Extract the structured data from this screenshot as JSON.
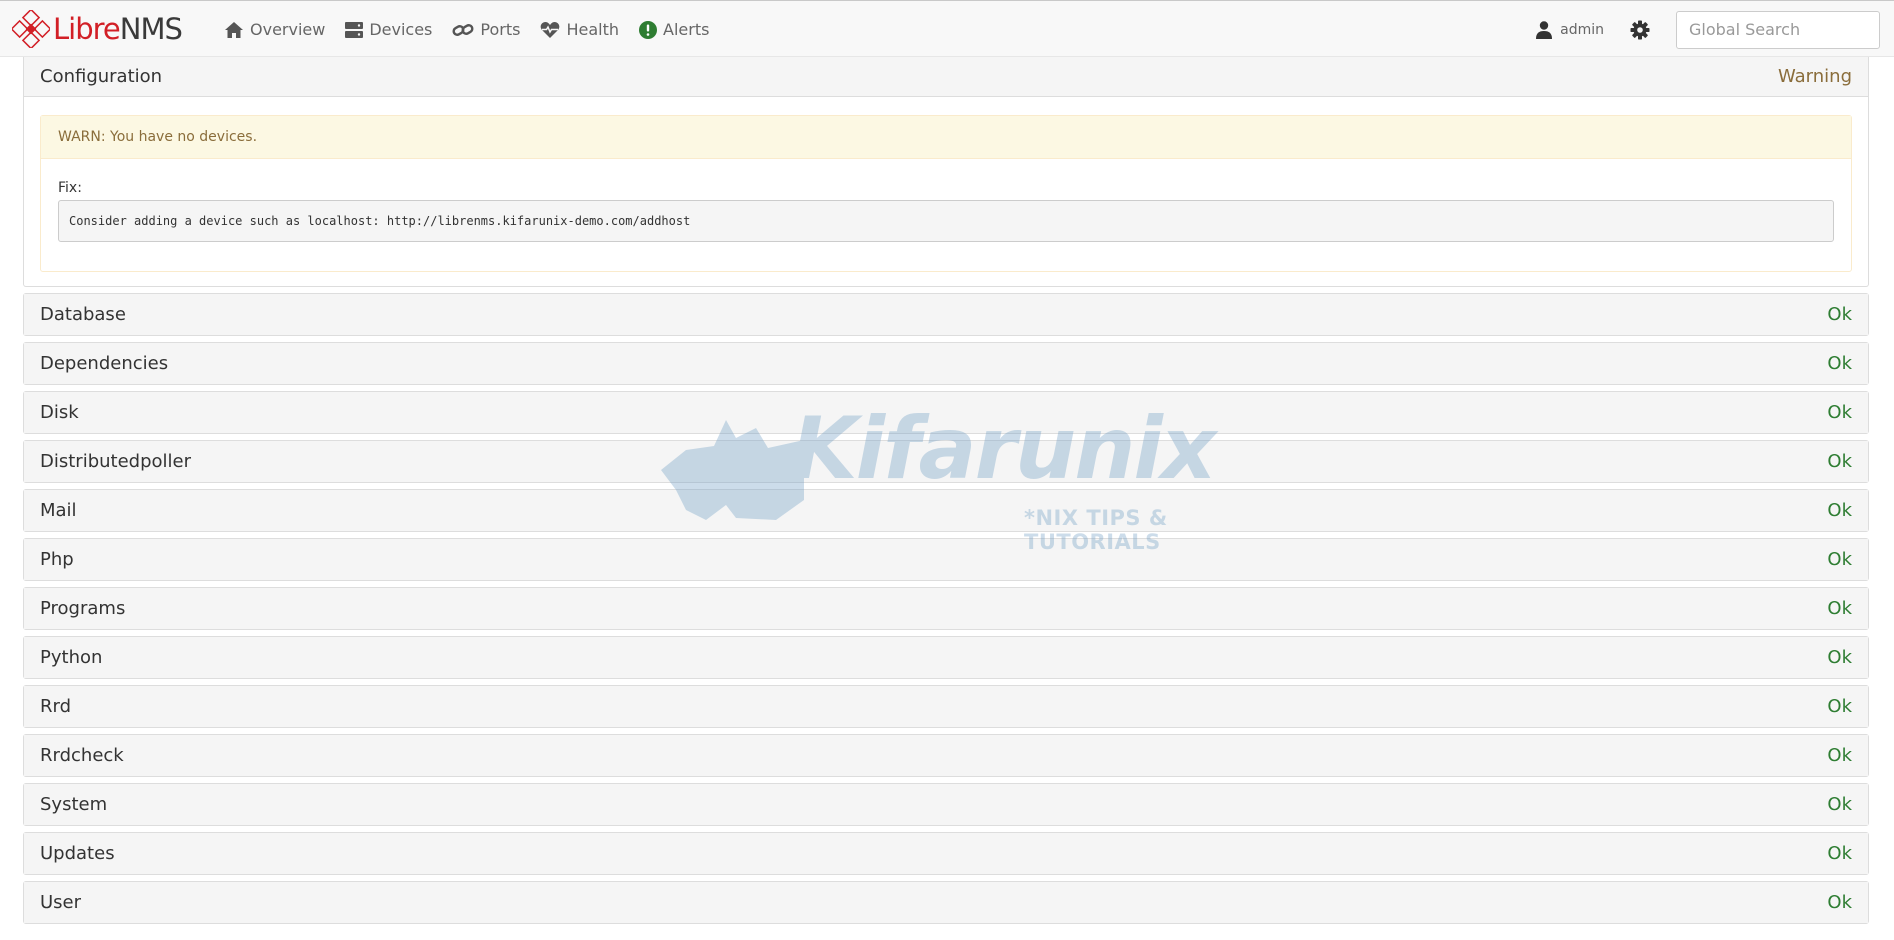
{
  "brand": {
    "part1": "Libre",
    "part2": "NMS"
  },
  "nav": {
    "items": [
      {
        "label": "Overview",
        "icon": "home-icon"
      },
      {
        "label": "Devices",
        "icon": "server-icon"
      },
      {
        "label": "Ports",
        "icon": "link-icon"
      },
      {
        "label": "Health",
        "icon": "heartbeat-icon"
      },
      {
        "label": "Alerts",
        "icon": "alert-circle-icon"
      }
    ],
    "user": "admin",
    "search_placeholder": "Global Search"
  },
  "colors": {
    "ok": "#2e7d32",
    "warning": "#8a6d3b",
    "alerts_icon": "#2e7d32",
    "brand_red": "#d21f26"
  },
  "configuration": {
    "title": "Configuration",
    "status": "Warning",
    "warn_message": "WARN: You have no devices.",
    "fix_label": "Fix:",
    "fix_text": "Consider adding a device such as localhost: http://librenms.kifarunix-demo.com/addhost"
  },
  "checks": [
    {
      "name": "Database",
      "status": "Ok"
    },
    {
      "name": "Dependencies",
      "status": "Ok"
    },
    {
      "name": "Disk",
      "status": "Ok"
    },
    {
      "name": "Distributedpoller",
      "status": "Ok"
    },
    {
      "name": "Mail",
      "status": "Ok"
    },
    {
      "name": "Php",
      "status": "Ok"
    },
    {
      "name": "Programs",
      "status": "Ok"
    },
    {
      "name": "Python",
      "status": "Ok"
    },
    {
      "name": "Rrd",
      "status": "Ok"
    },
    {
      "name": "Rrdcheck",
      "status": "Ok"
    },
    {
      "name": "System",
      "status": "Ok"
    },
    {
      "name": "Updates",
      "status": "Ok"
    },
    {
      "name": "User",
      "status": "Ok"
    }
  ],
  "watermark": {
    "text": "Kifarunix",
    "subtext": "*NIX TIPS & TUTORIALS"
  }
}
